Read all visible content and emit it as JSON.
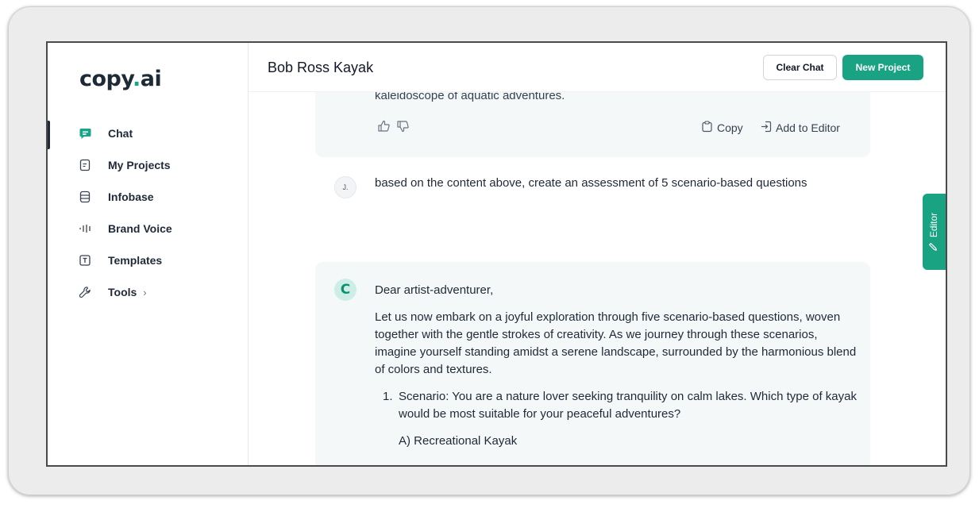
{
  "app": {
    "logo_text": "copy",
    "logo_dot": ".",
    "logo_suffix": "ai",
    "accent_color": "#1aa383"
  },
  "sidebar": {
    "items": [
      {
        "label": "Chat",
        "icon": "chat-bubble-icon",
        "active": true
      },
      {
        "label": "My Projects",
        "icon": "document-icon"
      },
      {
        "label": "Infobase",
        "icon": "database-icon"
      },
      {
        "label": "Brand Voice",
        "icon": "soundwave-icon"
      },
      {
        "label": "Templates",
        "icon": "template-icon"
      },
      {
        "label": "Tools",
        "icon": "wrench-icon",
        "chevron": "›"
      }
    ]
  },
  "header": {
    "title": "Bob Ross Kayak",
    "clear_label": "Clear Chat",
    "new_label": "New Project"
  },
  "messages": {
    "prev_fragment": "kaleidoscope of aquatic adventures.",
    "copy_label": "Copy",
    "add_to_editor_label": "Add to Editor",
    "user_avatar": "J.",
    "user_text": "based on the content above, create an assessment of 5 scenario-based questions",
    "ai_avatar": "C",
    "ai_greeting": "Dear artist-adventurer,",
    "ai_paragraph": "Let us now embark on a joyful exploration through five scenario-based questions, woven together with the gentle strokes of creativity. As we journey through these scenarios, imagine yourself standing amidst a serene landscape, surrounded by the harmonious blend of colors and textures.",
    "ai_q1_num": "1.",
    "ai_q1_text": "Scenario: You are a nature lover seeking tranquility on calm lakes. Which type of kayak would be most suitable for your peaceful adventures?",
    "ai_q1_optA": "A) Recreational Kayak"
  },
  "editor_tab": {
    "label": "Editor"
  }
}
